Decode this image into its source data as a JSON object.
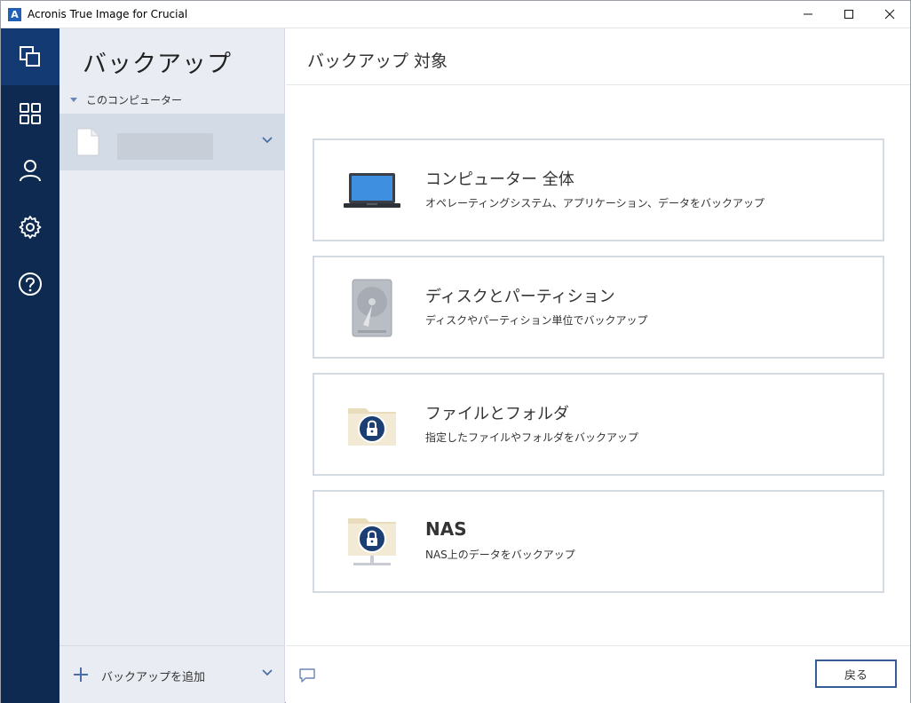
{
  "window": {
    "title": "Acronis True Image for Crucial",
    "app_icon_letter": "A"
  },
  "nav": {
    "items": [
      {
        "name": "backup",
        "icon": "backup-copy-icon",
        "active": true
      },
      {
        "name": "dashboard",
        "icon": "grid-icon",
        "active": false
      },
      {
        "name": "account",
        "icon": "user-icon",
        "active": false
      },
      {
        "name": "settings",
        "icon": "gear-icon",
        "active": false
      },
      {
        "name": "help",
        "icon": "help-icon",
        "active": false
      }
    ]
  },
  "sidebar": {
    "title": "バックアップ",
    "tree_header": "このコンピューター",
    "add_backup_label": "バックアップを追加"
  },
  "main": {
    "title": "バックアップ 対象",
    "options": [
      {
        "title": "コンピューター 全体",
        "desc": "オペレーティングシステム、アプリケーション、データをバックアップ",
        "icon": "laptop-icon"
      },
      {
        "title": "ディスクとパーティション",
        "desc": "ディスクやパーティション単位でバックアップ",
        "icon": "hard-disk-icon"
      },
      {
        "title": "ファイルとフォルダ",
        "desc": "指定したファイルやフォルダをバックアップ",
        "icon": "locked-folder-icon"
      },
      {
        "title": "NAS",
        "desc": "NAS上のデータをバックアップ",
        "icon": "nas-folder-icon"
      }
    ],
    "back_button": "戻る"
  },
  "colors": {
    "nav_bg": "#0e2a50",
    "nav_active": "#133a73",
    "sidebar_bg": "#e9edf3",
    "selected_item": "#d3dbe6",
    "accent": "#355c94"
  }
}
